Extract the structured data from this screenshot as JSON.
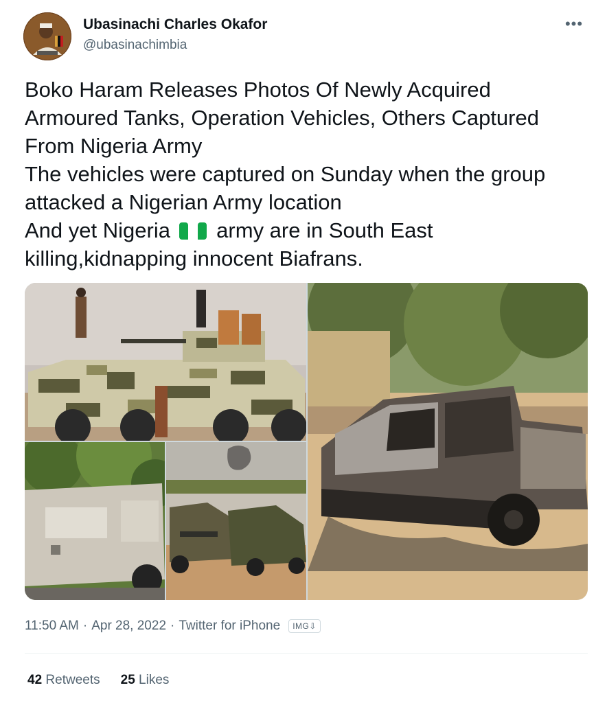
{
  "author": {
    "name": "Ubasinachi Charles Okafor",
    "handle": "@ubasinachimbia",
    "avatar_icon": "profile-photo"
  },
  "more_icon": "more-horizontal-icon",
  "tweet": {
    "lines": [
      "Boko Haram Releases Photos Of Newly Acquired",
      "Armoured Tanks, Operation Vehicles, Others Captured",
      "From Nigeria Army",
      "The vehicles were captured on Sunday when the group",
      "attacked a Nigerian Army location"
    ],
    "line6_before_flag": "And yet Nigeria",
    "flag_emoji": "nigeria-flag-emoji",
    "line6_after_flag": "army are in South East",
    "line7": "killing,kidnapping innocent Biafrans."
  },
  "media": {
    "count": 4,
    "items": [
      "armoured-vehicle-photo",
      "mrap-vehicle-photo",
      "captured-pickups-photo",
      "burnt-pickup-photo"
    ]
  },
  "meta": {
    "time": "11:50 AM",
    "date": "Apr 28, 2022",
    "source": "Twitter for iPhone",
    "badge": "IMG⇩"
  },
  "stats": {
    "retweets_count": "42",
    "retweets_label": "Retweets",
    "likes_count": "25",
    "likes_label": "Likes"
  },
  "colors": {
    "text_primary": "#0f1419",
    "text_secondary": "#536471",
    "divider": "#eff3f4",
    "flag_green": "#008751"
  }
}
